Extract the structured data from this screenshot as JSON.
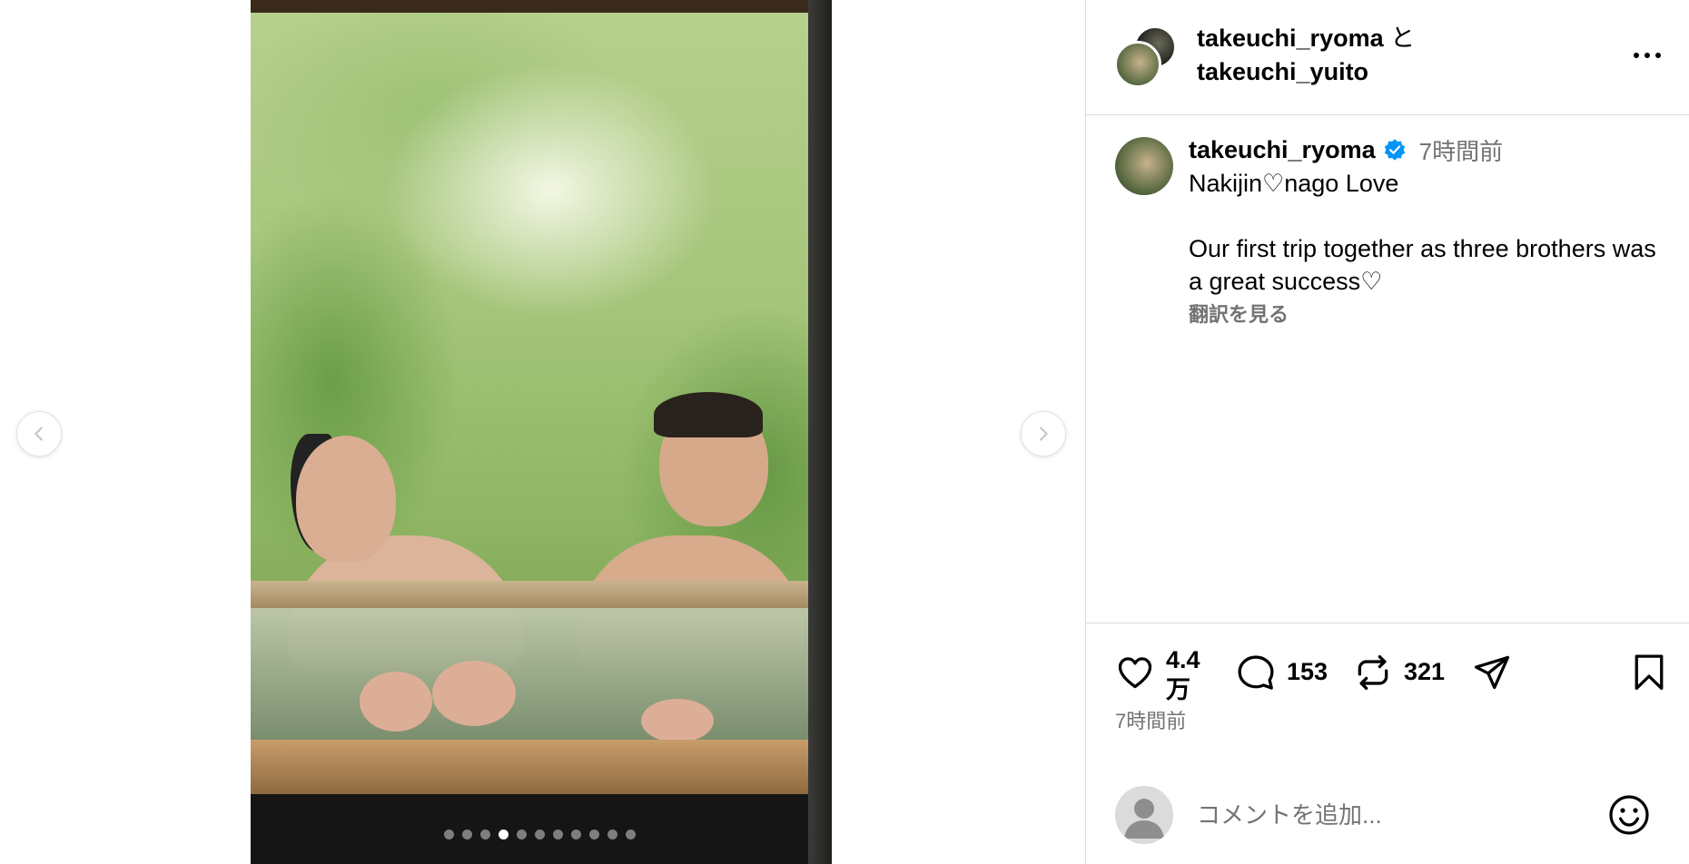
{
  "carousel": {
    "slide_count": 11,
    "active_index": 3,
    "prev_icon": "chevron-left-icon",
    "next_icon": "chevron-right-icon"
  },
  "header": {
    "user1": "takeuchi_ryoma",
    "conjunction": "と",
    "user2": "takeuchi_yuito",
    "more_icon": "more-horizontal-icon"
  },
  "caption": {
    "username": "takeuchi_ryoma",
    "verified": true,
    "time": "7時間前",
    "text": "Nakijin♡nago  Love\n\nOur first trip together as three brothers was a great success♡",
    "translate_label": "翻訳を見る"
  },
  "actions": {
    "like_count_top": "4.4",
    "like_count_bottom": "万",
    "comment_count": "153",
    "repost_count": "321",
    "posted_time": "7時間前"
  },
  "comment": {
    "placeholder": "コメントを追加..."
  },
  "colors": {
    "verified_blue": "#0095f6",
    "secondary_text": "#737373",
    "divider": "#dbdbdb"
  }
}
